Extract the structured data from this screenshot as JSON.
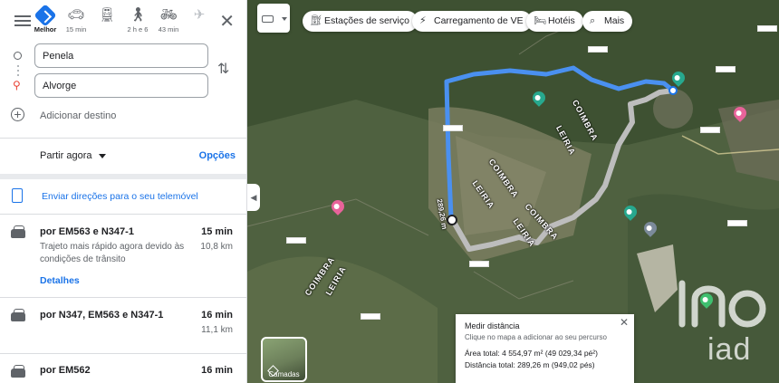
{
  "modes": [
    {
      "label": "Melhor",
      "icon": "best-route-icon",
      "active": true
    },
    {
      "label": "15 min",
      "icon": "car-icon"
    },
    {
      "label": "",
      "icon": "train-icon"
    },
    {
      "label": "2 h e 6",
      "icon": "walk-icon"
    },
    {
      "label": "43 min",
      "icon": "bike-icon"
    },
    {
      "label": "",
      "icon": "plane-icon",
      "disabled": true
    }
  ],
  "directions": {
    "origin": "Penela",
    "destination": "Alvorge",
    "add_destination": "Adicionar destino",
    "depart": "Partir agora",
    "options": "Opções",
    "send": "Enviar direções para o seu telemóvel"
  },
  "routes": [
    {
      "title": "por EM563 e N347-1",
      "time": "15 min",
      "distance": "10,8 km",
      "description": "Trajeto mais rápido agora devido às condições de trânsito",
      "link": "Detalhes"
    },
    {
      "title": "por N347, EM563 e N347-1",
      "time": "16 min",
      "distance": "11,1 km"
    },
    {
      "title": "por EM562",
      "time": "16 min"
    }
  ],
  "chips": [
    {
      "label": "Estações de serviço",
      "icon": "gas-station-icon"
    },
    {
      "label": "Carregamento de VE",
      "icon": "ev-charging-icon"
    },
    {
      "label": "Hotéis",
      "icon": "hotel-icon"
    },
    {
      "label": "Mais",
      "icon": "search-icon"
    }
  ],
  "map": {
    "region_labels": [
      "COIMBRA",
      "LEIRIA",
      "COIMBRA",
      "LEIRIA",
      "COIMBRA",
      "LEIRIA",
      "COIMBRA",
      "LEIRIA"
    ],
    "route_label": "289,26 m",
    "layers_label": "Camadas",
    "watermark": "iad",
    "route_color": "#4a90f0",
    "measure_color": "#bdbdbd"
  },
  "measure": {
    "title": "Medir distância",
    "hint": "Clique no mapa a adicionar ao seu percurso",
    "area": "Área total: 4 554,97 m² (49 029,34 pé²)",
    "distance": "Distância total: 289,26 m (949,02 pés)"
  }
}
